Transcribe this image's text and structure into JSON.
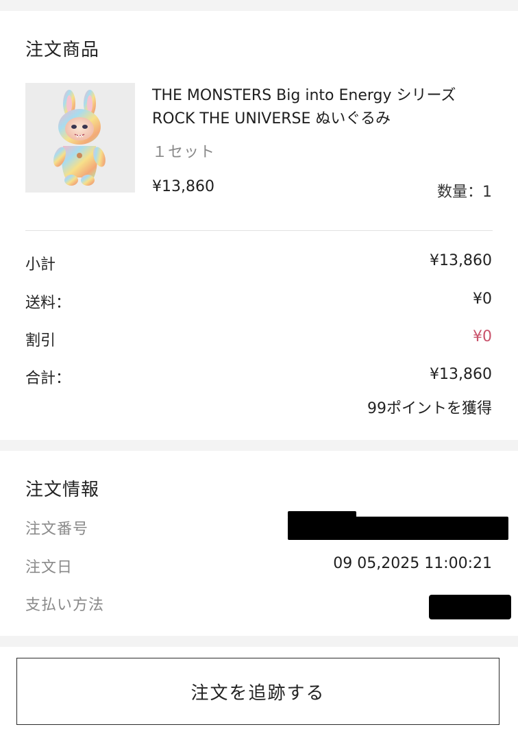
{
  "products_section": {
    "title": "注文商品",
    "item": {
      "image_icon": "monster-plush-figure",
      "name_line1": "THE MONSTERS Big into Energy シリーズ",
      "name_line2": "ROCK THE UNIVERSE ぬいぐるみ",
      "spec": "１セット",
      "price": "¥13,860",
      "quantity": "数量：1"
    }
  },
  "summary": {
    "subtotal_label": "小計",
    "subtotal_value": "¥13,860",
    "shipping_label": "送料：",
    "shipping_value": "¥0",
    "discount_label": "割引",
    "discount_value": "¥0",
    "total_label": "合計：",
    "total_value": "¥13,860",
    "points": "99ポイントを獲得",
    "discount_color": "#c9526b"
  },
  "order_info": {
    "title": "注文情報",
    "order_number_label": "注文番号",
    "order_date_label": "注文日",
    "order_date_value": "09 05,2025 11:00:21",
    "payment_method_label": "支払い方法"
  },
  "actions": {
    "track_order_label": "注文を追跡する"
  }
}
